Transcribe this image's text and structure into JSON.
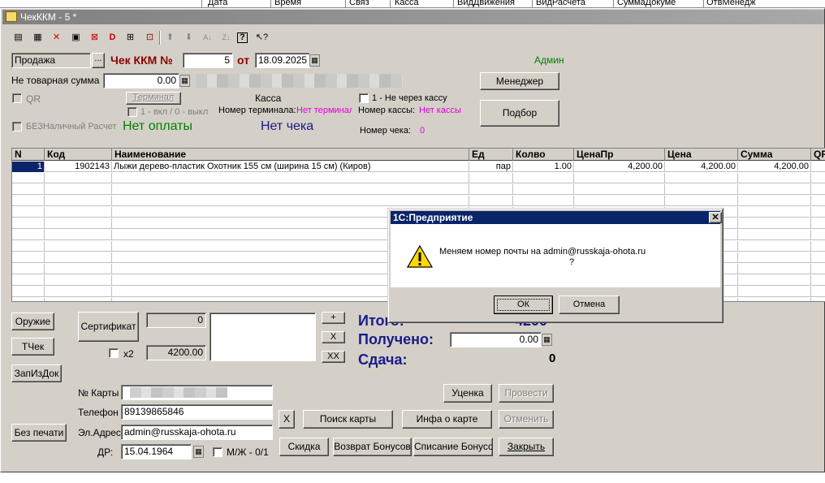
{
  "background_table": {
    "headers": [
      "Дата",
      "Время",
      "Связ",
      "Касса",
      "ВидДвижения",
      "ВидРасчета",
      "СуммаДокуме",
      "ОтвМенедж"
    ]
  },
  "window": {
    "title": "ЧекККМ - 5 *"
  },
  "toolbar": {
    "icons": [
      "new-doc-icon",
      "copy-doc-icon",
      "delete-doc-icon",
      "edit-icon",
      "post-icon",
      "unpost-icon",
      "structure-icon",
      "filter-icon",
      "move-up-icon",
      "move-down-icon",
      "sort-asc-icon",
      "sort-desc-icon",
      "help-icon",
      "pointer-help-icon"
    ]
  },
  "header": {
    "operation_type": "Продажа",
    "select_btn": "...",
    "doc_label": "Чек ККМ №",
    "doc_number": "5",
    "date_from_label": "от",
    "date": "18.09.2025",
    "user": "Админ",
    "non_goods_label": "Не товарная сумма",
    "non_goods_value": "0.00",
    "manager_btn": "Менеджер",
    "qr_label": "QR",
    "terminal_btn": "Терминал",
    "on_off_label": "1 - вкл / 0 - выкл",
    "cashdesk_label": "Касса",
    "terminal_no_label": "Номер терминала:",
    "terminal_no_value": "Нет терминала",
    "not_through_label": "1 - Не через кассу",
    "cashdesk_no_label": "Номер кассы:",
    "cashdesk_no_value": "Нет кассы",
    "pick_btn": "Подбор",
    "cashless_label": "БЕЗНаличный Расчет",
    "no_payment": "Нет оплаты",
    "no_receipt": "Нет чека",
    "receipt_no_label": "Номер чека:",
    "receipt_no_value": "0"
  },
  "grid": {
    "columns": [
      "N",
      "Код",
      "Наименование",
      "Ед",
      "Колво",
      "ЦенаПр",
      "Цена",
      "Сумма",
      "QR"
    ],
    "rows": [
      {
        "n": "1",
        "code": "1902143",
        "name": "Лыжи дерево-пластик Охотник 155 см  (ширина 15 см) (Киров)",
        "unit": "пар",
        "qty": "1.00",
        "price_pr": "4,200.00",
        "price": "4,200.00",
        "sum": "4,200.00"
      }
    ]
  },
  "bottom": {
    "weapon_btn": "Оружие",
    "tcheck_btn": "ТЧек",
    "zapizdok_btn": "ЗапИзДок",
    "noprint_btn": "Без печати",
    "certificate_btn": "Сертификат",
    "cert_value": "0",
    "x2_label": "x2",
    "x2_value": "4200.00",
    "plus_btn": "+",
    "x_btn": "X",
    "xx_btn": "XX",
    "total_label": "Итого:",
    "total_value": "4200",
    "received_label": "Получено:",
    "received_value": "0.00",
    "change_label": "Сдача:",
    "change_value": "0",
    "card_label": "№ Карты",
    "phone_label": "Телефон",
    "phone_value": "89139865846",
    "email_label": "Эл.Адрес:",
    "email_value": "admin@russkaja-ohota.ru",
    "dob_label": "ДР:",
    "dob_value": "15.04.1964",
    "gender_label": "М/Ж - 0/1",
    "clear_btn": "X",
    "search_card_btn": "Поиск карты",
    "card_info_btn": "Инфа о карте",
    "discount_btn": "Скидка",
    "bonus_return_btn": "Возврат Бонусов",
    "bonus_writeoff_btn": "Списание Бонусов",
    "markdown_btn": "Уценка",
    "post_btn": "Провести",
    "cancel_btn": "Отменить",
    "close_btn": "Закрыть"
  },
  "dialog": {
    "title": "1С:Предприятие",
    "message": "Меняем номер почты на admin@russkaja-ohota.ru",
    "message2": "?",
    "ok": "ОК",
    "cancel": "Отмена"
  }
}
